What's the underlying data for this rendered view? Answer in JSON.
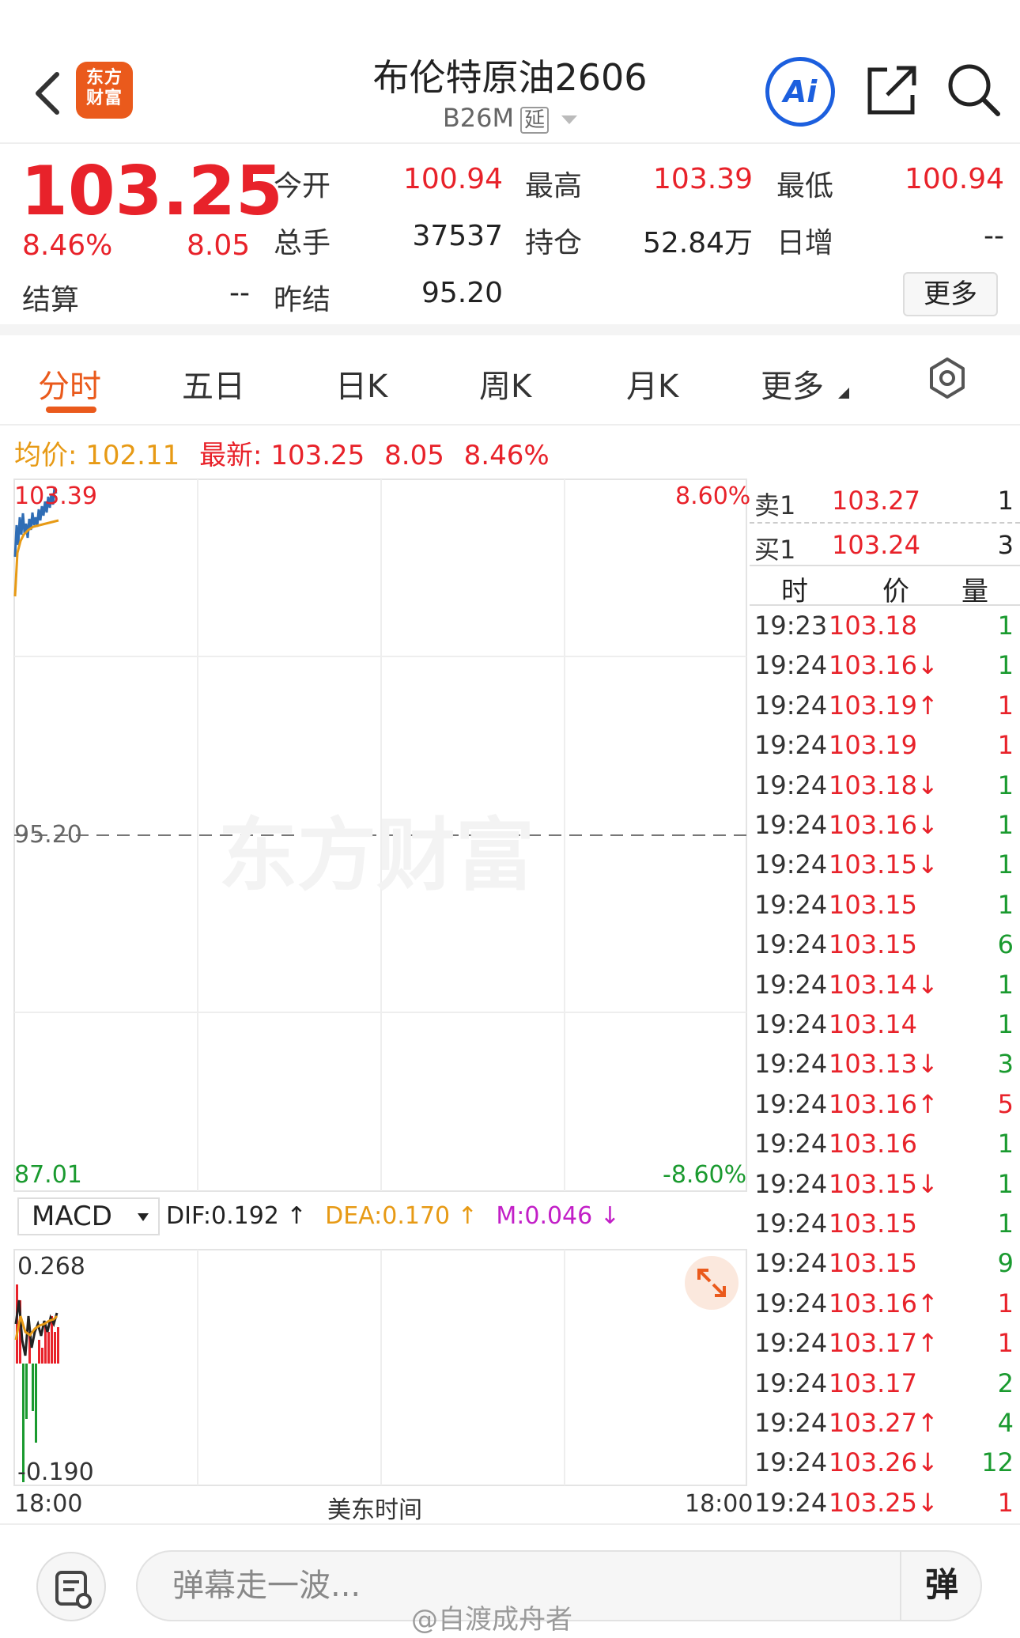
{
  "header": {
    "logo_line1": "东方",
    "logo_line2": "财富",
    "title": "布伦特原油2606",
    "code": "B26M",
    "delay_tag": "延",
    "ai_label": "Ai"
  },
  "quote": {
    "price": "103.25",
    "change_pct": "8.46%",
    "change": "8.05",
    "open_label": "今开",
    "open": "100.94",
    "high_label": "最高",
    "high": "103.39",
    "low_label": "最低",
    "low": "100.94",
    "volume_label": "总手",
    "volume": "37537",
    "oi_label": "持仓",
    "oi": "52.84万",
    "daily_inc_label": "日增",
    "daily_inc": "--",
    "settle_label": "结算",
    "settle": "--",
    "prev_settle_label": "昨结",
    "prev_settle": "95.20",
    "more_label": "更多"
  },
  "tabs": [
    "分时",
    "五日",
    "日K",
    "周K",
    "月K",
    "更多"
  ],
  "avg": {
    "avg_label": "均价:",
    "avg_value": "102.11",
    "latest_label": "最新:",
    "latest_price": "103.25",
    "latest_change": "8.05",
    "latest_pct": "8.46%"
  },
  "chart": {
    "top_price": "103.39",
    "top_pct": "8.60%",
    "mid_price": "95.20",
    "bottom_price": "87.01",
    "bottom_pct": "-8.60%",
    "watermark": "东方财富",
    "x_start": "18:00",
    "x_mid": "美东时间",
    "x_end": "18:00"
  },
  "macd": {
    "selector": "MACD",
    "dif": "DIF:0.192 ↑",
    "dea": "DEA:0.170 ↑",
    "m": "M:0.046 ↓",
    "top": "0.268",
    "bottom": "-0.190"
  },
  "orderbook": {
    "sell_label": "卖1",
    "sell_price": "103.27",
    "sell_qty": "1",
    "buy_label": "买1",
    "buy_price": "103.24",
    "buy_qty": "3"
  },
  "ticks_header": {
    "time": "时",
    "price": "价",
    "qty": "量"
  },
  "ticks": [
    {
      "t": "19:23",
      "p": "103.18",
      "v": "1",
      "c": "g"
    },
    {
      "t": "19:24",
      "p": "103.16↓",
      "v": "1",
      "c": "g"
    },
    {
      "t": "19:24",
      "p": "103.19↑",
      "v": "1",
      "c": "rd"
    },
    {
      "t": "19:24",
      "p": "103.19",
      "v": "1",
      "c": "rd"
    },
    {
      "t": "19:24",
      "p": "103.18↓",
      "v": "1",
      "c": "g"
    },
    {
      "t": "19:24",
      "p": "103.16↓",
      "v": "1",
      "c": "g"
    },
    {
      "t": "19:24",
      "p": "103.15↓",
      "v": "1",
      "c": "g"
    },
    {
      "t": "19:24",
      "p": "103.15",
      "v": "1",
      "c": "g"
    },
    {
      "t": "19:24",
      "p": "103.15",
      "v": "6",
      "c": "g"
    },
    {
      "t": "19:24",
      "p": "103.14↓",
      "v": "1",
      "c": "g"
    },
    {
      "t": "19:24",
      "p": "103.14",
      "v": "1",
      "c": "g"
    },
    {
      "t": "19:24",
      "p": "103.13↓",
      "v": "3",
      "c": "g"
    },
    {
      "t": "19:24",
      "p": "103.16↑",
      "v": "5",
      "c": "rd"
    },
    {
      "t": "19:24",
      "p": "103.16",
      "v": "1",
      "c": "g"
    },
    {
      "t": "19:24",
      "p": "103.15↓",
      "v": "1",
      "c": "g"
    },
    {
      "t": "19:24",
      "p": "103.15",
      "v": "1",
      "c": "g"
    },
    {
      "t": "19:24",
      "p": "103.15",
      "v": "9",
      "c": "g"
    },
    {
      "t": "19:24",
      "p": "103.16↑",
      "v": "1",
      "c": "rd"
    },
    {
      "t": "19:24",
      "p": "103.17↑",
      "v": "1",
      "c": "rd"
    },
    {
      "t": "19:24",
      "p": "103.17",
      "v": "2",
      "c": "g"
    },
    {
      "t": "19:24",
      "p": "103.27↑",
      "v": "4",
      "c": "g"
    },
    {
      "t": "19:24",
      "p": "103.26↓",
      "v": "12",
      "c": "g"
    },
    {
      "t": "19:24",
      "p": "103.25↓",
      "v": "1",
      "c": "rd"
    }
  ],
  "bottom": {
    "placeholder": "弹幕走一波...",
    "toggle": "弹",
    "credit": "@自渡成舟者"
  },
  "colors": {
    "up": "#e8222a",
    "down": "#1a9a2f",
    "accent": "#ea5a1c",
    "avg": "#e79a15",
    "price_line": "#2f6db5",
    "ai_blue": "#1c5fde"
  }
}
